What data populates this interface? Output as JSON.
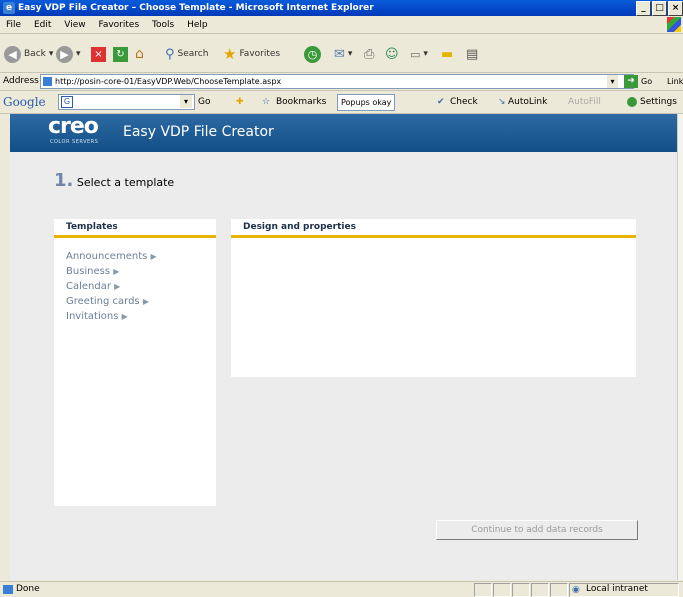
{
  "window": {
    "title": "Easy VDP File Creator – Choose Template - Microsoft Internet Explorer"
  },
  "menu": [
    "File",
    "Edit",
    "View",
    "Favorites",
    "Tools",
    "Help"
  ],
  "toolbar": {
    "back": "Back",
    "search": "Search",
    "favorites": "Favorites"
  },
  "address": {
    "label": "Address",
    "url": "http://posin-core-01/EasyVDP.Web/ChooseTemplate.aspx",
    "go": "Go",
    "links": "Links"
  },
  "google": {
    "logo": "Google",
    "go": "Go",
    "bookmarks": "Bookmarks",
    "popups": "Popups okay",
    "check": "Check",
    "autolink": "AutoLink",
    "autofill": "AutoFill",
    "settings": "Settings"
  },
  "app": {
    "logo": "creo",
    "logo_sub": "COLOR SERVERS",
    "title": "Easy VDP File Creator",
    "step_number": "1.",
    "step_title": "Select a template",
    "templates_header": "Templates",
    "design_header": "Design and properties",
    "templates": [
      "Announcements",
      "Business",
      "Calendar",
      "Greeting cards",
      "Invitations"
    ],
    "continue_button": "Continue to add data records"
  },
  "status": {
    "left": "Done",
    "zone": "Local intranet"
  },
  "colors": {
    "banner": "#1c5a94",
    "accent": "#e7b400",
    "link": "#6b7f99"
  }
}
